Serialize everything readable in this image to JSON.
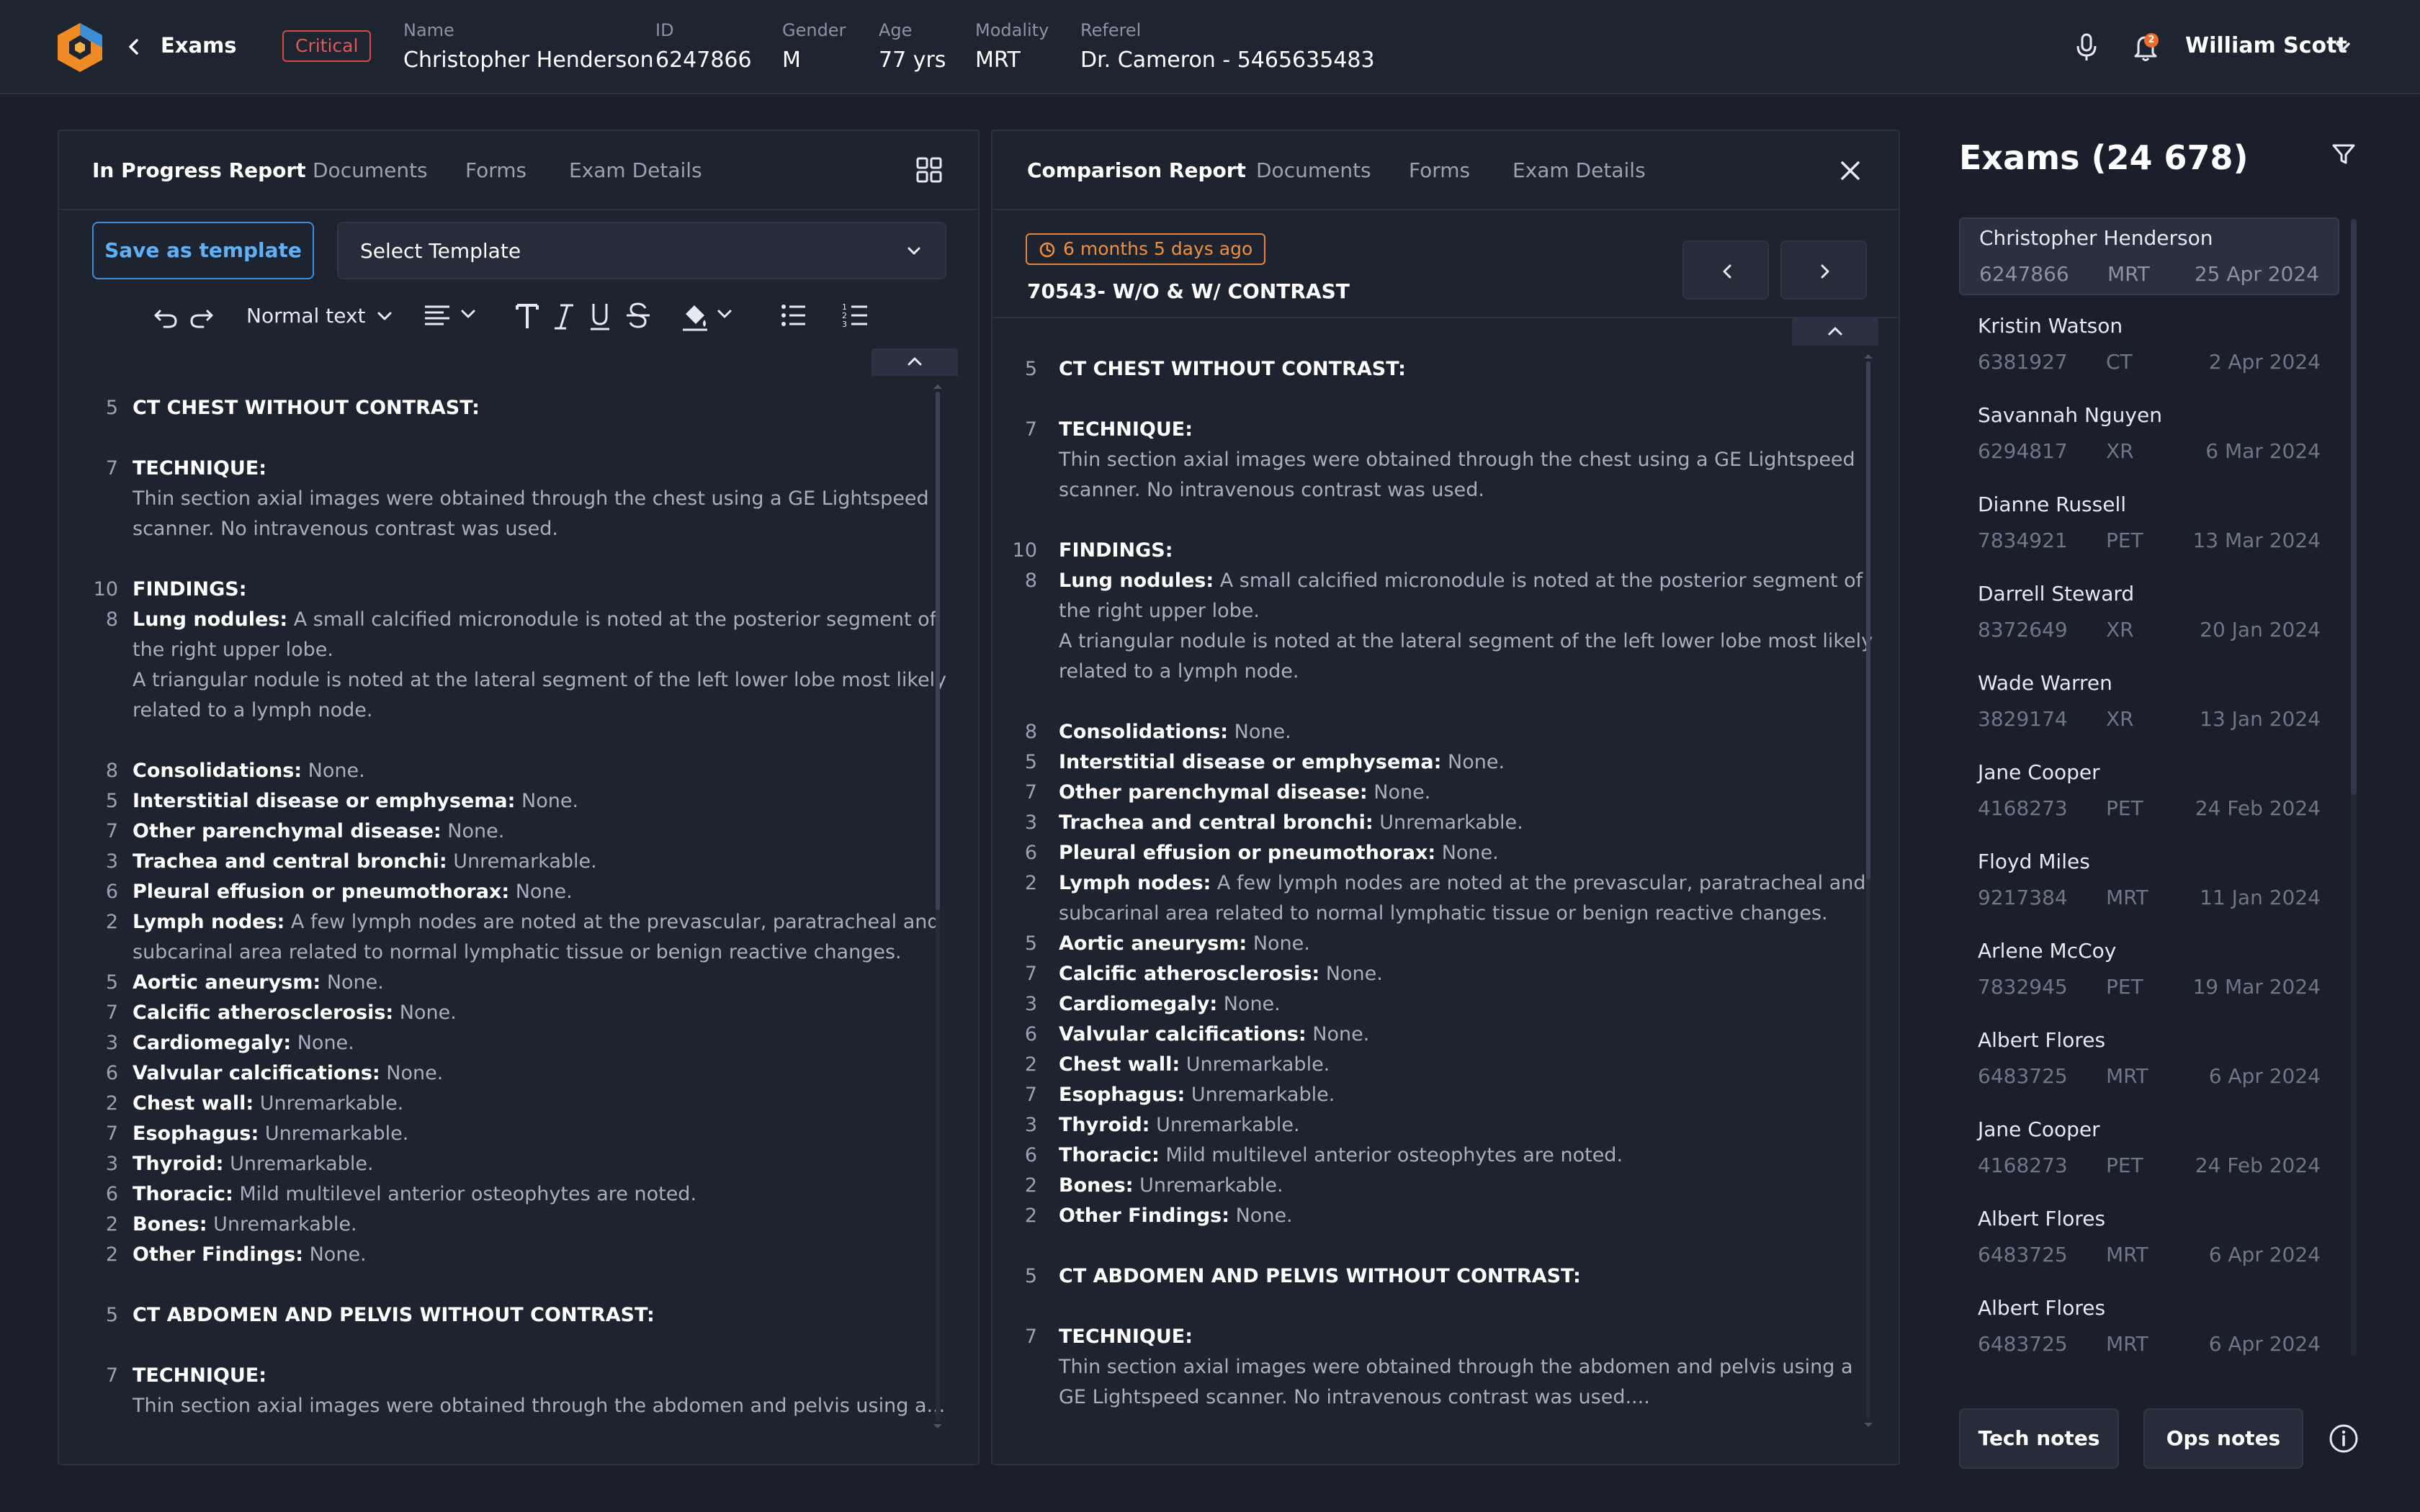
{
  "colors": {
    "background": "#1a1f2b",
    "panel": "#1e2330",
    "critical": "#e0575a",
    "accent_blue": "#5fb0f5",
    "time_badge_orange": "#f0903f",
    "notification": "#f06a2a"
  },
  "header": {
    "title": "Exams",
    "badge": "Critical",
    "patient": {
      "name_label": "Name",
      "name": "Christopher Henderson",
      "id_label": "ID",
      "id": "6247866",
      "gender_label": "Gender",
      "gender": "M",
      "age_label": "Age",
      "age": "77 yrs",
      "modality_label": "Modality",
      "modality": "MRT",
      "referer_label": "Referel",
      "referer": "Dr. Cameron - 5465635483"
    },
    "notification_count": "2",
    "user_name": "William Scott",
    "icons": [
      "app-logo",
      "chevron-left-icon",
      "microphone-icon",
      "bell-icon",
      "chevron-down-icon"
    ]
  },
  "left_panel": {
    "tabs": [
      "In Progress Report",
      "Documents",
      "Forms",
      "Exam Details"
    ],
    "save_template": "Save as template",
    "select_template": "Select Template",
    "text_style": "Normal text",
    "toolbar_icons": [
      "undo-icon",
      "redo-icon",
      "align-left-icon",
      "text-size-icon",
      "italic-icon",
      "underline-icon",
      "strikethrough-icon",
      "fill-color-icon",
      "bullet-list-icon",
      "numbered-list-icon"
    ],
    "report_lines": [
      {
        "n": "5",
        "label": "CT CHEST WITHOUT CONTRAST:",
        "text": ""
      },
      {
        "n": "",
        "label": "",
        "text": ""
      },
      {
        "n": "7",
        "label": "TECHNIQUE:",
        "text": ""
      },
      {
        "n": "",
        "label": "",
        "text": "Thin section axial images were obtained through the chest using a GE Lightspeed"
      },
      {
        "n": "",
        "label": "",
        "text": "scanner. No intravenous contrast was used."
      },
      {
        "n": "",
        "label": "",
        "text": ""
      },
      {
        "n": "10",
        "label": "FINDINGS:",
        "text": ""
      },
      {
        "n": "8",
        "label": "Lung nodules:",
        "text": " A small calcified micronodule is noted at the posterior segment of"
      },
      {
        "n": "",
        "label": "",
        "text": "the right upper lobe."
      },
      {
        "n": "",
        "label": "",
        "text": "A triangular nodule is noted at the lateral segment of the left lower lobe most likely"
      },
      {
        "n": "",
        "label": "",
        "text": "related to a lymph node."
      },
      {
        "n": "",
        "label": "",
        "text": ""
      },
      {
        "n": "8",
        "label": "Consolidations:",
        "text": " None."
      },
      {
        "n": "5",
        "label": "Interstitial disease or emphysema:",
        "text": " None."
      },
      {
        "n": "7",
        "label": "Other parenchymal disease:",
        "text": " None."
      },
      {
        "n": "3",
        "label": "Trachea and central bronchi:",
        "text": " Unremarkable."
      },
      {
        "n": "6",
        "label": "Pleural effusion or pneumothorax:",
        "text": " None."
      },
      {
        "n": "2",
        "label": "Lymph nodes:",
        "text": " A few lymph nodes are noted at the prevascular, paratracheal and"
      },
      {
        "n": "",
        "label": "",
        "text": "subcarinal area related to normal lymphatic tissue or benign reactive changes."
      },
      {
        "n": "5",
        "label": "Aortic aneurysm:",
        "text": " None."
      },
      {
        "n": "7",
        "label": "Calcific atherosclerosis:",
        "text": " None."
      },
      {
        "n": "3",
        "label": "Cardiomegaly:",
        "text": " None."
      },
      {
        "n": "6",
        "label": "Valvular calcifications:",
        "text": " None."
      },
      {
        "n": "2",
        "label": "Chest wall:",
        "text": " Unremarkable."
      },
      {
        "n": "7",
        "label": "Esophagus:",
        "text": " Unremarkable."
      },
      {
        "n": "3",
        "label": "Thyroid:",
        "text": " Unremarkable."
      },
      {
        "n": "6",
        "label": "Thoracic:",
        "text": " Mild multilevel anterior osteophytes are noted."
      },
      {
        "n": "2",
        "label": "Bones:",
        "text": " Unremarkable."
      },
      {
        "n": "2",
        "label": "Other Findings:",
        "text": " None."
      },
      {
        "n": "",
        "label": "",
        "text": ""
      },
      {
        "n": "5",
        "label": "CT ABDOMEN AND PELVIS WITHOUT CONTRAST:",
        "text": ""
      },
      {
        "n": "",
        "label": "",
        "text": ""
      },
      {
        "n": "7",
        "label": "TECHNIQUE:",
        "text": ""
      },
      {
        "n": "",
        "label": "",
        "text": "Thin section axial images were obtained through the abdomen and pelvis using a..."
      }
    ]
  },
  "middle_panel": {
    "tabs": [
      "Comparison Report",
      "Documents",
      "Forms",
      "Exam Details"
    ],
    "time_badge": "6 months 5 days ago",
    "exam_title": "70543- W/O & W/ CONTRAST",
    "report_lines": [
      {
        "n": "5",
        "label": "CT CHEST WITHOUT CONTRAST:",
        "text": ""
      },
      {
        "n": "",
        "label": "",
        "text": ""
      },
      {
        "n": "7",
        "label": "TECHNIQUE:",
        "text": ""
      },
      {
        "n": "",
        "label": "",
        "text": "Thin section axial images were obtained through the chest using a GE Lightspeed"
      },
      {
        "n": "",
        "label": "",
        "text": "scanner. No intravenous contrast was used."
      },
      {
        "n": "",
        "label": "",
        "text": ""
      },
      {
        "n": "10",
        "label": "FINDINGS:",
        "text": ""
      },
      {
        "n": "8",
        "label": "Lung nodules:",
        "text": " A small calcified micronodule is noted at the posterior segment of"
      },
      {
        "n": "",
        "label": "",
        "text": "the right upper lobe."
      },
      {
        "n": "",
        "label": "",
        "text": "A triangular nodule is noted at the lateral segment of the left lower lobe most likely"
      },
      {
        "n": "",
        "label": "",
        "text": "related to a lymph node."
      },
      {
        "n": "",
        "label": "",
        "text": ""
      },
      {
        "n": "8",
        "label": "Consolidations:",
        "text": " None."
      },
      {
        "n": "5",
        "label": "Interstitial disease or emphysema:",
        "text": " None."
      },
      {
        "n": "7",
        "label": "Other parenchymal disease:",
        "text": " None."
      },
      {
        "n": "3",
        "label": "Trachea and central bronchi:",
        "text": " Unremarkable."
      },
      {
        "n": "6",
        "label": "Pleural effusion or pneumothorax:",
        "text": " None."
      },
      {
        "n": "2",
        "label": "Lymph nodes:",
        "text": " A few lymph nodes are noted at the prevascular, paratracheal and"
      },
      {
        "n": "",
        "label": "",
        "text": "subcarinal area related to normal lymphatic tissue or benign reactive changes."
      },
      {
        "n": "5",
        "label": "Aortic aneurysm:",
        "text": " None."
      },
      {
        "n": "7",
        "label": "Calcific atherosclerosis:",
        "text": " None."
      },
      {
        "n": "3",
        "label": "Cardiomegaly:",
        "text": " None."
      },
      {
        "n": "6",
        "label": "Valvular calcifications:",
        "text": " None."
      },
      {
        "n": "2",
        "label": "Chest wall:",
        "text": " Unremarkable."
      },
      {
        "n": "7",
        "label": "Esophagus:",
        "text": " Unremarkable."
      },
      {
        "n": "3",
        "label": "Thyroid:",
        "text": " Unremarkable."
      },
      {
        "n": "6",
        "label": "Thoracic:",
        "text": " Mild multilevel anterior osteophytes are noted."
      },
      {
        "n": "2",
        "label": "Bones:",
        "text": " Unremarkable."
      },
      {
        "n": "2",
        "label": "Other Findings:",
        "text": " None."
      },
      {
        "n": "",
        "label": "",
        "text": ""
      },
      {
        "n": "5",
        "label": "CT ABDOMEN AND PELVIS WITHOUT CONTRAST:",
        "text": ""
      },
      {
        "n": "",
        "label": "",
        "text": ""
      },
      {
        "n": "7",
        "label": "TECHNIQUE:",
        "text": ""
      },
      {
        "n": "",
        "label": "",
        "text": "Thin section axial images were obtained through the abdomen and pelvis using a"
      },
      {
        "n": "",
        "label": "",
        "text": "GE Lightspeed scanner. No intravenous contrast was used...."
      }
    ]
  },
  "sidebar": {
    "title": "Exams (24 678)",
    "exams": [
      {
        "name": "Christopher Henderson",
        "id": "6247866",
        "modality": "MRT",
        "date": "25 Apr 2024",
        "selected": true
      },
      {
        "name": "Kristin Watson",
        "id": "6381927",
        "modality": "CT",
        "date": "2 Apr 2024"
      },
      {
        "name": "Savannah Nguyen",
        "id": "6294817",
        "modality": "XR",
        "date": "6 Mar 2024"
      },
      {
        "name": "Dianne Russell",
        "id": "7834921",
        "modality": "PET",
        "date": "13 Mar 2024"
      },
      {
        "name": "Darrell Steward",
        "id": "8372649",
        "modality": "XR",
        "date": "20 Jan 2024"
      },
      {
        "name": "Wade Warren",
        "id": "3829174",
        "modality": "XR",
        "date": "13 Jan 2024"
      },
      {
        "name": "Jane Cooper",
        "id": "4168273",
        "modality": "PET",
        "date": "24 Feb 2024"
      },
      {
        "name": "Floyd Miles",
        "id": "9217384",
        "modality": "MRT",
        "date": "11 Jan 2024"
      },
      {
        "name": "Arlene McCoy",
        "id": "7832945",
        "modality": "PET",
        "date": "19 Mar 2024"
      },
      {
        "name": "Albert Flores",
        "id": "6483725",
        "modality": "MRT",
        "date": "6 Apr 2024"
      },
      {
        "name": "Jane Cooper",
        "id": "4168273",
        "modality": "PET",
        "date": "24 Feb 2024"
      },
      {
        "name": "Albert Flores",
        "id": "6483725",
        "modality": "MRT",
        "date": "6 Apr 2024"
      },
      {
        "name": "Albert Flores",
        "id": "6483725",
        "modality": "MRT",
        "date": "6 Apr 2024"
      }
    ],
    "tech_notes": "Tech notes",
    "ops_notes": "Ops notes"
  }
}
